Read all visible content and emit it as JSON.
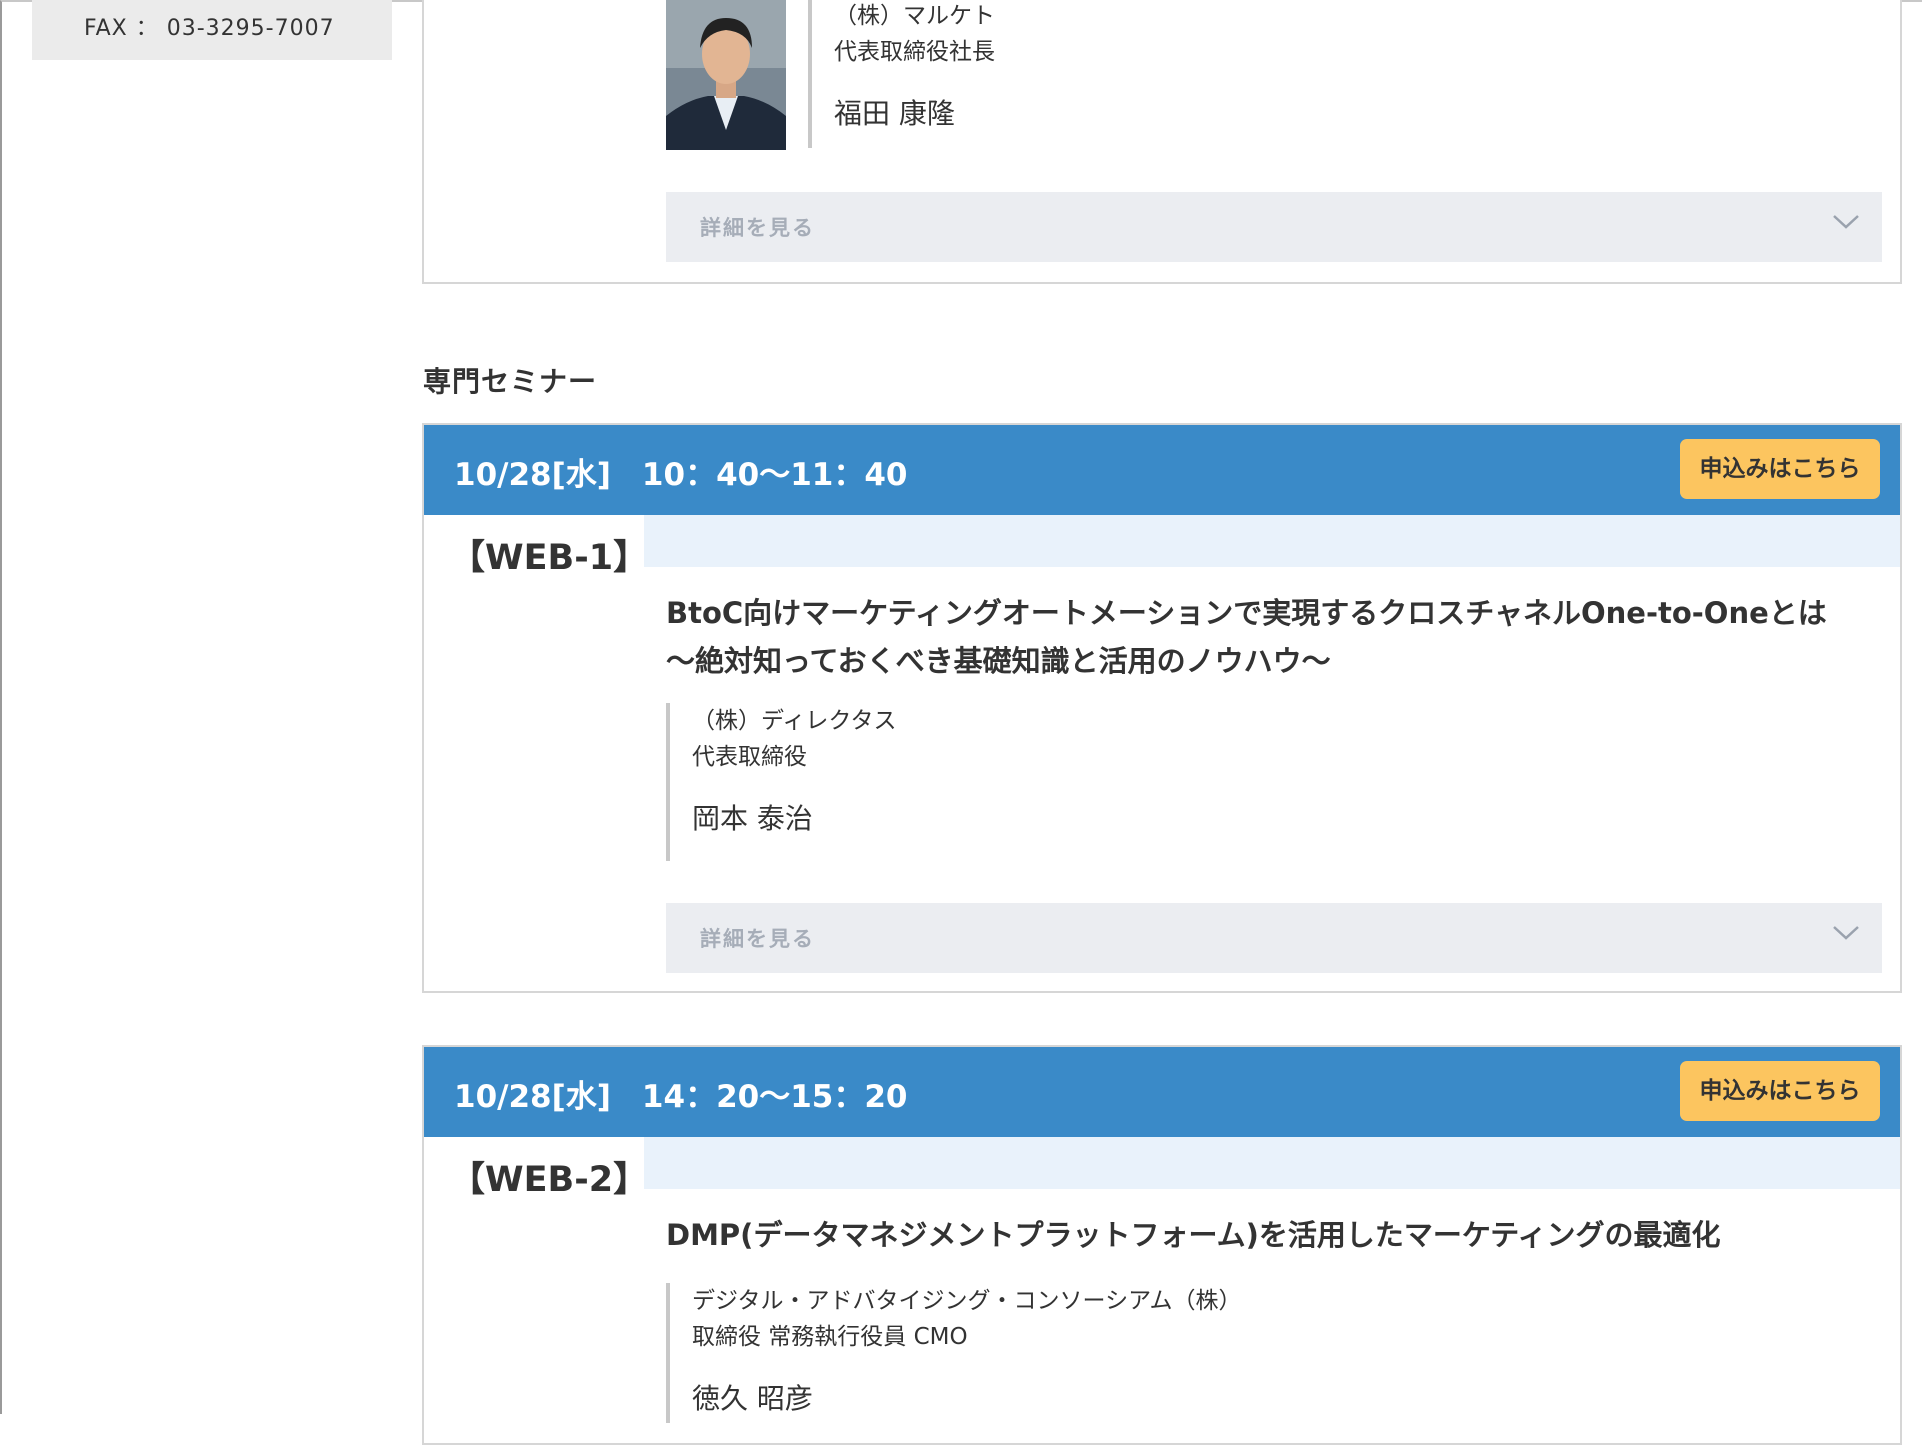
{
  "sidebar": {
    "fax": "FAX ： 03-3295-7007"
  },
  "top_card": {
    "company": "（株）マルケト",
    "title": "代表取締役社長",
    "name": "福田 康隆",
    "details_label": "詳細を見る"
  },
  "section": {
    "title": "専門セミナー"
  },
  "seminars": [
    {
      "time": "10/28[水]　10：40〜11：40",
      "apply_label": "申込みはこちら",
      "code": "【WEB-1】",
      "title_line1": "BtoC向けマーケティングオートメーションで実現するクロスチャネルOne-to-Oneとは",
      "title_line2": "〜絶対知っておくべき基礎知識と活用のノウハウ〜",
      "company": "（株）ディレクタス",
      "speaker_title": "代表取締役",
      "name": "岡本 泰治",
      "details_label": "詳細を見る"
    },
    {
      "time": "10/28[水]　14：20〜15：20",
      "apply_label": "申込みはこちら",
      "code": "【WEB-2】",
      "title_line1": "DMP(データマネジメントプラットフォーム)を活用したマーケティングの最適化",
      "company": "デジタル・アドバタイジング・コンソーシアム（株）",
      "speaker_title": "取締役 常務執行役員 CMO",
      "name": "徳久 昭彦"
    }
  ],
  "icons": {
    "details_toggle": "chevron-down-icon",
    "photo": "speaker-photo"
  },
  "colors": {
    "header_blue": "#3a8ac8",
    "apply_yellow": "#fcc55f",
    "band_blue": "#e9f2fb",
    "details_gray": "#ebedf1"
  }
}
